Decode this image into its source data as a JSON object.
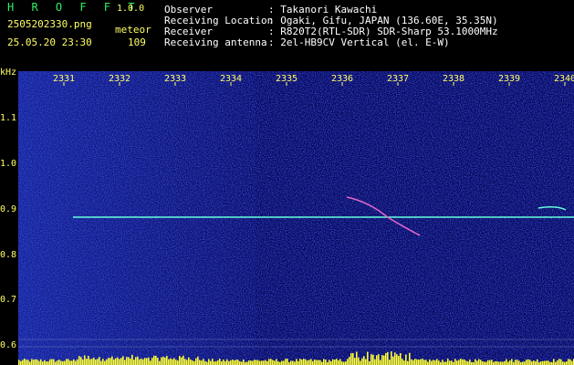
{
  "app": {
    "logo": "H R O F F T",
    "version": "1.0.0",
    "filename": "2505202330.png",
    "datetime": "25.05.20 23:30",
    "event_label": "meteor",
    "event_count": "109"
  },
  "info": {
    "observer_label": "Observer",
    "observer_value": ": Takanori Kawachi",
    "location_label": "Receiving Location",
    "location_value": ": Ogaki, Gifu, JAPAN (136.60E, 35.35N)",
    "receiver_label": "Receiver",
    "receiver_value": ": R820T2(RTL-SDR) SDR-Sharp 53.1000MHz",
    "antenna_label": "Receiving antenna",
    "antenna_value": ": 2el-HB9CV Vertical (el. E-W)"
  },
  "axis": {
    "y_unit": "kHz",
    "y_ticks": [
      "1.1",
      "1.0",
      "0.9",
      "0.8",
      "0.7",
      "0.6"
    ],
    "x_ticks": [
      "2331",
      "2332",
      "2333",
      "2334",
      "2335",
      "2336",
      "2337",
      "2338",
      "2339",
      "2340"
    ]
  },
  "colors": {
    "background": "#000000",
    "spectrogram": "#0a0a6e",
    "label": "#ffff66",
    "carrier": "#66ffdd"
  }
}
